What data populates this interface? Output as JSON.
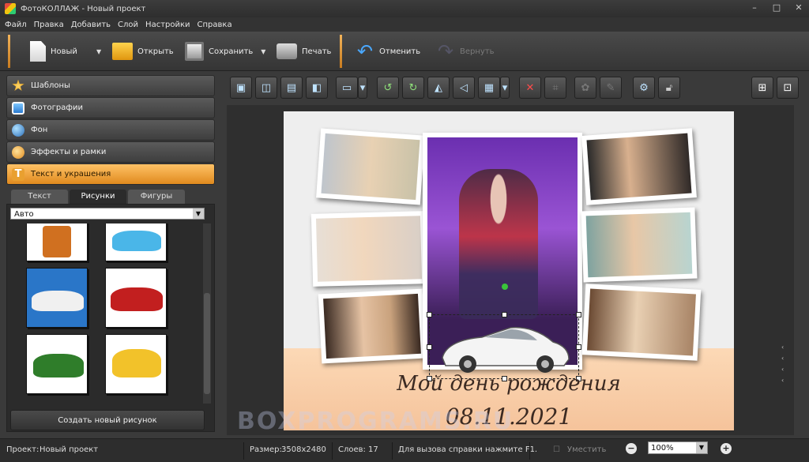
{
  "window": {
    "title": "ФотоКОЛЛАЖ - Новый проект",
    "controls": [
      "–",
      "□",
      "✕"
    ]
  },
  "menu": [
    "Файл",
    "Правка",
    "Добавить",
    "Слой",
    "Настройки",
    "Справка"
  ],
  "toolbar": {
    "new_label": "Новый",
    "open_label": "Открыть",
    "save_label": "Сохранить",
    "print_label": "Печать",
    "undo_label": "Отменить",
    "redo_label": "Вернуть"
  },
  "sidebar": {
    "sections": [
      "Шаблоны",
      "Фотографии",
      "Фон",
      "Эффекты и рамки",
      "Текст и украшения"
    ],
    "tabs": [
      "Текст",
      "Рисунки",
      "Фигуры"
    ],
    "active_tab": "Рисунки",
    "category_select": "Авто",
    "create_button": "Создать новый рисунок"
  },
  "canvas": {
    "text_line1": "Мой день рождения",
    "text_line2": "08.11.2021"
  },
  "watermark": "BOXPROGRAMS.RU",
  "status": {
    "project_label": "Проект:",
    "project_value": "Новый проект",
    "size_label": "Размер:",
    "size_value": "3508x2480",
    "layers_label": "Слоев:",
    "layers_value": "17",
    "help_text": "Для вызова справки нажмите F1.",
    "shrink_label": "Уместить",
    "zoom_value": "100%"
  },
  "colors": {
    "accent": "#f2a640",
    "selected_thumb": "#2a76c8"
  }
}
